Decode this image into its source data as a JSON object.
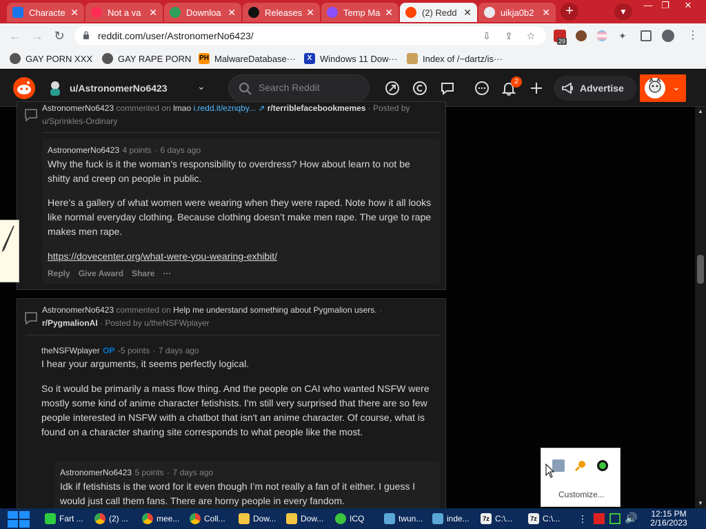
{
  "browser": {
    "tabs": [
      {
        "title": "Characte",
        "favicon": "doc-icon"
      },
      {
        "title": "Not a va",
        "favicon": "heart-icon"
      },
      {
        "title": "Downloa",
        "favicon": "globe-icon"
      },
      {
        "title": "Releases",
        "favicon": "github-icon"
      },
      {
        "title": "Temp Ma",
        "favicon": "mail-icon"
      },
      {
        "title": "(2) Redd",
        "favicon": "reddit-icon"
      },
      {
        "title": "uikja0b2",
        "favicon": "globe-icon"
      }
    ],
    "active_tab_index": 5,
    "url": "reddit.com/user/AstronomerNo6423/",
    "extension_badge": "29",
    "bookmarks": [
      {
        "label": "GAY PORN XXX",
        "icon": "bookmark-icon"
      },
      {
        "label": "GAY RAPE PORN",
        "icon": "bookmark-icon"
      },
      {
        "label": "MalwareDatabase···",
        "icon": "ph-icon"
      },
      {
        "label": "Windows 11 Dow···",
        "icon": "x-icon"
      },
      {
        "label": "Index of /~dartz/is···",
        "icon": "index-icon"
      }
    ]
  },
  "reddit": {
    "header": {
      "username": "u/AstronomerNo6423",
      "search_placeholder": "Search Reddit",
      "notification_count": "2",
      "advertise_label": "Advertise"
    },
    "comments": [
      {
        "meta_prefix": "AstronomerNo6423",
        "meta_commented": "commented on",
        "post_title": "lmao",
        "post_link": "i.redd.it/eznqby...",
        "subreddit": "r/terriblefacebookmemes",
        "posted_by": "· Posted by",
        "posted_by_user": "u/Sprinkles-Ordinary",
        "reply": {
          "author": "AstronomerNo6423",
          "points": "4 points",
          "sep": "·",
          "age": "6 days ago",
          "paragraphs": [
            "Why the fuck is it the woman’s responsibility to overdress? How about learn to not be shitty and creep on people in public.",
            "Here’s a gallery of what women were wearing when they were raped. Note how it all looks like normal everyday clothing. Because clothing doesn’t make men rape. The urge to rape makes men rape."
          ],
          "link": "https://dovecenter.org/what-were-you-wearing-exhibit/",
          "actions": [
            "Reply",
            "Give Award",
            "Share",
            "···"
          ]
        }
      },
      {
        "meta_prefix": "AstronomerNo6423",
        "meta_commented": "commented on",
        "post_title": "Help me understand something about Pygmalion users.",
        "post_sep": "·",
        "subreddit": "r/PygmalionAI",
        "posted_by": "· Posted by",
        "posted_by_user": "u/theNSFWplayer",
        "reply": {
          "author": "theNSFWplayer",
          "op": "OP",
          "points": "-5 points",
          "sep": "·",
          "age": "7 days ago",
          "paragraphs": [
            "I hear your arguments, it seems perfectly logical.",
            "So it would be primarily a mass flow thing. And the people on CAI who wanted NSFW were mostly some kind of anime character fetishists. I'm still very surprised that there are so few people interested in NSFW with a chatbot that isn't an anime character. Of course, what is found on a character sharing site corresponds to what people like the most."
          ]
        },
        "nested_reply": {
          "author": "AstronomerNo6423",
          "points": "5 points",
          "sep": "·",
          "age": "7 days ago",
          "text": "Idk if fetishists is the word for it even though I’m not really a fan of it either. I guess I would just call them fans. There are horny people in every fandom."
        }
      }
    ]
  },
  "tray_popup": {
    "customize_label": "Customize..."
  },
  "taskbar": {
    "items": [
      {
        "label": "Fart ...",
        "icon": "notepad-icon"
      },
      {
        "label": "(2) ...",
        "icon": "chrome-icon"
      },
      {
        "label": "mee...",
        "icon": "chrome-icon"
      },
      {
        "label": "Coll...",
        "icon": "chrome-icon"
      },
      {
        "label": "Dow...",
        "icon": "folder-icon"
      },
      {
        "label": "Dow...",
        "icon": "folder-icon"
      },
      {
        "label": "ICQ",
        "icon": "icq-icon"
      },
      {
        "label": "twun...",
        "icon": "editor-icon"
      },
      {
        "label": "inde...",
        "icon": "editor-icon"
      },
      {
        "label": "C:\\...",
        "icon": "7zip-icon"
      },
      {
        "label": "C:\\...",
        "icon": "7zip-icon"
      }
    ],
    "time": "12:15 PM",
    "date": "2/16/2023"
  },
  "colors": {
    "tab_bar": "#c8232c",
    "reddit_orange": "#ff4500",
    "link_blue": "#4fbcff",
    "taskbar": "#0c2a5a"
  }
}
